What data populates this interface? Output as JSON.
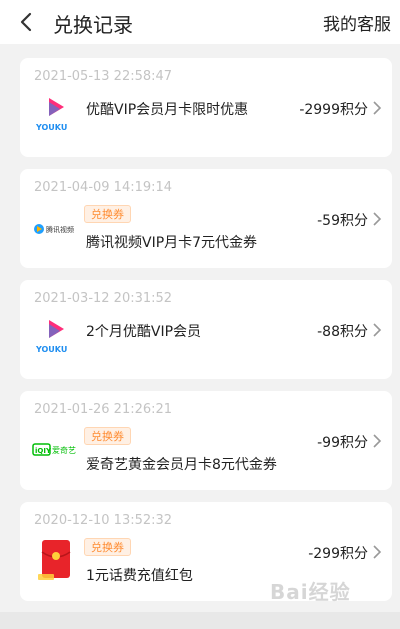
{
  "header": {
    "title": "兑换记录",
    "service_label": "我的客服"
  },
  "records": [
    {
      "date": "2021-05-13 22:58:47",
      "logo": "youku-logo-icon",
      "logo_text": "YOUKU",
      "tag": "",
      "title": "优酷VIP会员月卡限时优惠",
      "points": "-2999积分"
    },
    {
      "date": "2021-04-09 14:19:14",
      "logo": "tencent-video-logo-icon",
      "logo_text": "腾讯视频",
      "tag": "兑换券",
      "title": "腾讯视频VIP月卡7元代金券",
      "points": "-59积分"
    },
    {
      "date": "2021-03-12 20:31:52",
      "logo": "youku-logo-icon",
      "logo_text": "YOUKU",
      "tag": "",
      "title": "2个月优酷VIP会员",
      "points": "-88积分"
    },
    {
      "date": "2021-01-26 21:26:21",
      "logo": "iqiyi-logo-icon",
      "logo_text": "爱奇艺",
      "logo_mark": "iQIY",
      "tag": "兑换券",
      "title": "爱奇艺黄金会员月卡8元代金券",
      "points": "-99积分"
    },
    {
      "date": "2020-12-10 13:52:32",
      "logo": "red-envelope-icon",
      "tag": "兑换券",
      "title": "1元话费充值红包",
      "points": "-299积分"
    }
  ],
  "colors": {
    "tag_text": "#ff8c32",
    "tag_bg": "#fff0e4",
    "youku_pink": "#ff2e7a",
    "youku_blue": "#1f8ef0",
    "iqiyi_green": "#00be06",
    "envelope_red": "#e8242a"
  },
  "watermark": "Bai经验"
}
